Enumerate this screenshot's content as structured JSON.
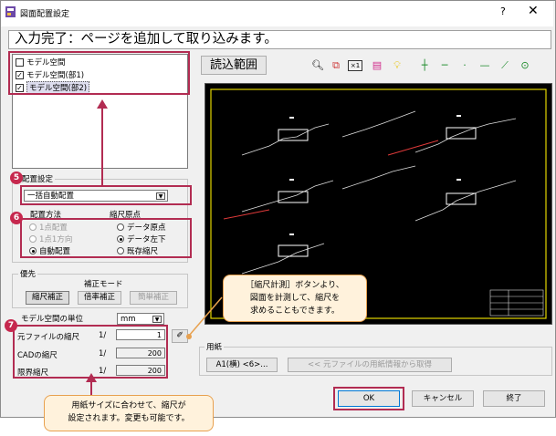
{
  "window": {
    "title": "図面配置設定",
    "help_glyph": "?",
    "close_glyph": "✕"
  },
  "status_message": "入力完了：ページを追加して取り込みます。",
  "space_list": {
    "items": [
      {
        "label": "モデル空間",
        "checked": false
      },
      {
        "label": "モデル空間(部1)",
        "checked": true
      },
      {
        "label": "モデル空間(部2)",
        "checked": true
      }
    ]
  },
  "placement": {
    "group_label": "配置設定",
    "combo_value": "一括自動配置",
    "method_header": "配置方法",
    "origin_header": "縮尺原点",
    "method_options": [
      {
        "label": "1点配置",
        "enabled": false,
        "selected": false
      },
      {
        "label": "1点1方向",
        "enabled": false,
        "selected": false
      },
      {
        "label": "自動配置",
        "enabled": true,
        "selected": true
      }
    ],
    "origin_options": [
      {
        "label": "データ原点",
        "selected": false
      },
      {
        "label": "データ左下",
        "selected": true
      },
      {
        "label": "既存縮尺",
        "selected": false
      }
    ]
  },
  "priority": {
    "group_label": "優先",
    "mode_label": "補正モード",
    "buttons": [
      {
        "label": "縮尺補正",
        "state": "pressed"
      },
      {
        "label": "倍率補正",
        "state": "normal"
      },
      {
        "label": "簡単補正",
        "state": "disabled"
      }
    ]
  },
  "scale": {
    "unit_label": "モデル空間の単位",
    "unit_value": "mm",
    "prefix": "1/",
    "rows": [
      {
        "label": "元ファイルの縮尺",
        "value": "1"
      },
      {
        "label": "CADの縮尺",
        "value": "200"
      },
      {
        "label": "限界縮尺",
        "value": "200"
      }
    ]
  },
  "toolbar": {
    "import_range_label": "読込範囲",
    "icons": [
      "zoom-icon",
      "fit-page-icon",
      "scale-measure-icon",
      "layer-icon",
      "lightbulb-icon",
      "snap-point-icon",
      "snap-h-icon",
      "snap-midpoint-icon",
      "snap-line-icon",
      "snap-tangent-icon",
      "snap-center-icon"
    ]
  },
  "paper": {
    "group_label": "用紙",
    "size_button": "A1(横) <6>...",
    "from_source_button": "<< 元ファイルの用紙情報から取得"
  },
  "footer": {
    "ok": "OK",
    "cancel": "キャンセル",
    "exit": "終了"
  },
  "callouts": {
    "measure_tip_lines": [
      "［縮尺計測］ボタンより、",
      "図面を計測して、縮尺を",
      "求めることもできます。"
    ],
    "paper_tip_lines": [
      "用紙サイズに合わせて、縮尺が",
      "設定されます。変更も可能です。"
    ]
  },
  "badges": [
    "5",
    "6",
    "7"
  ],
  "colors": {
    "annotation_red": "#b22c52",
    "callout_fill": "#fff2dc",
    "callout_border": "#e8a14f",
    "preview_bg": "#000000",
    "drawing_yellow": "#e3d400"
  }
}
